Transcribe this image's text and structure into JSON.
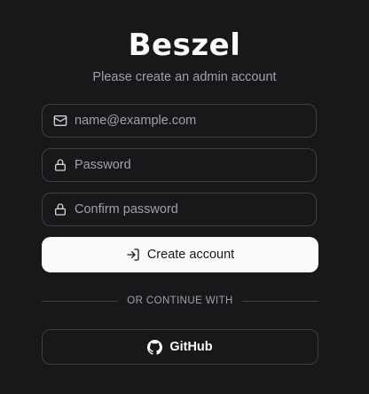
{
  "brand": {
    "name": "Beszel"
  },
  "subtitle": "Please create an admin account",
  "form": {
    "email": {
      "placeholder": "name@example.com",
      "value": "",
      "icon": "mail-icon"
    },
    "password": {
      "placeholder": "Password",
      "value": "",
      "icon": "lock-icon"
    },
    "confirm_password": {
      "placeholder": "Confirm password",
      "value": "",
      "icon": "lock-icon"
    },
    "submit_label": "Create account",
    "submit_icon": "log-in-icon"
  },
  "divider_text": "OR CONTINUE WITH",
  "oauth": {
    "github_label": "GitHub",
    "github_icon": "github-icon"
  },
  "colors": {
    "background": "#18181b",
    "border": "#3f3f46",
    "muted_text": "#a1a1aa",
    "primary_button_bg": "#fafafa",
    "primary_button_text": "#18181b"
  }
}
